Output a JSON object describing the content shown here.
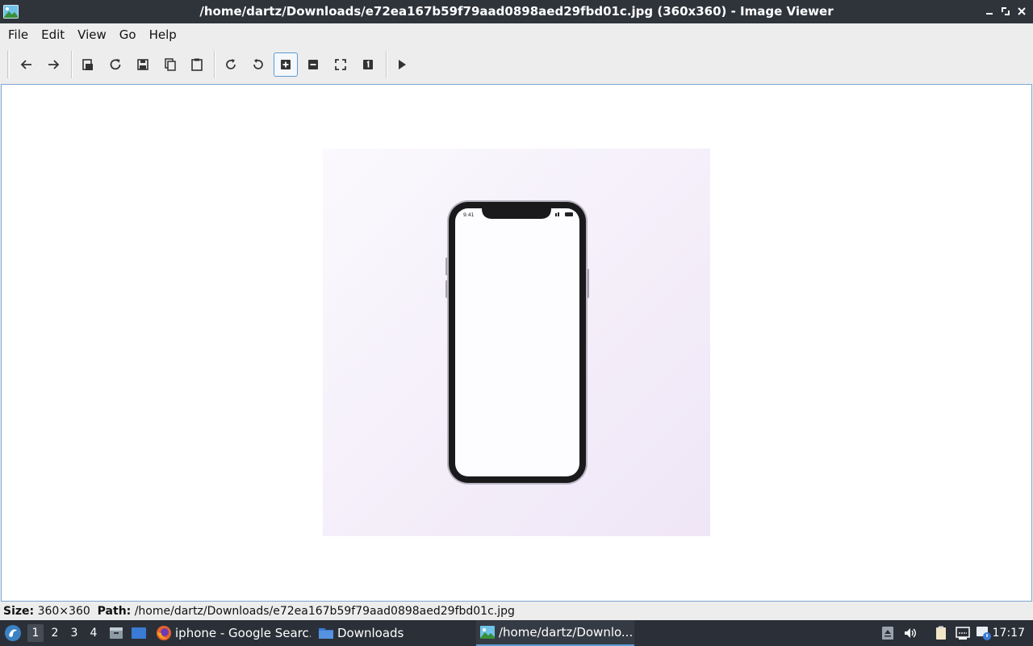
{
  "window": {
    "title": "/home/dartz/Downloads/e72ea167b59f79aad0898aed29fbd01c.jpg (360x360) - Image Viewer",
    "app_icon": "image-viewer-icon",
    "controls": [
      "minimize-icon",
      "maximize-icon",
      "close-icon"
    ]
  },
  "menubar": {
    "items": [
      "File",
      "Edit",
      "View",
      "Go",
      "Help"
    ]
  },
  "toolbar": {
    "buttons": [
      {
        "name": "back",
        "icon": "arrow-left-icon"
      },
      {
        "name": "forward",
        "icon": "arrow-right-icon"
      },
      {
        "name": "open",
        "icon": "open-file-icon"
      },
      {
        "name": "reload",
        "icon": "reload-icon"
      },
      {
        "name": "save",
        "icon": "save-icon"
      },
      {
        "name": "copy",
        "icon": "copy-icon"
      },
      {
        "name": "paste",
        "icon": "paste-icon"
      },
      {
        "name": "rotate-clockwise",
        "icon": "rotate-cw-icon"
      },
      {
        "name": "rotate-counterclockwise",
        "icon": "rotate-ccw-icon"
      },
      {
        "name": "zoom-in",
        "icon": "zoom-in-icon",
        "active": true
      },
      {
        "name": "zoom-out",
        "icon": "zoom-out-icon"
      },
      {
        "name": "fit",
        "icon": "fit-window-icon"
      },
      {
        "name": "original-size",
        "icon": "original-size-icon"
      },
      {
        "name": "slideshow",
        "icon": "play-icon"
      }
    ]
  },
  "phone_screen": {
    "status_time": "9:41"
  },
  "statusbar": {
    "size_label": "Size:",
    "size_value": "360×360",
    "path_label": "Path:",
    "path_value": "/home/dartz/Downloads/e72ea167b59f79aad0898aed29fbd01c.jpg"
  },
  "taskbar": {
    "start_icon": "start-menu-icon",
    "workspaces": [
      "1",
      "2",
      "3",
      "4"
    ],
    "active_workspace": "1",
    "launchers": [
      "file-manager-icon",
      "desktop-icon"
    ],
    "tasks": [
      {
        "label": "iphone - Google Searc...",
        "icon": "firefox-icon",
        "active": false
      },
      {
        "label": "Downloads",
        "icon": "folder-icon",
        "active": false
      },
      {
        "label": "/home/dartz/Downlo...",
        "icon": "image-viewer-icon",
        "active": true
      }
    ],
    "tray": [
      "eject-icon",
      "volume-icon",
      "clipboard-icon",
      "network-icon",
      "notification-icon"
    ],
    "clock": "17:17"
  },
  "colors": {
    "titlebar_bg": "#2f343b",
    "taskbar_bg": "#2b3038",
    "accent": "#5b9bd5",
    "window_bg": "#ededed"
  }
}
